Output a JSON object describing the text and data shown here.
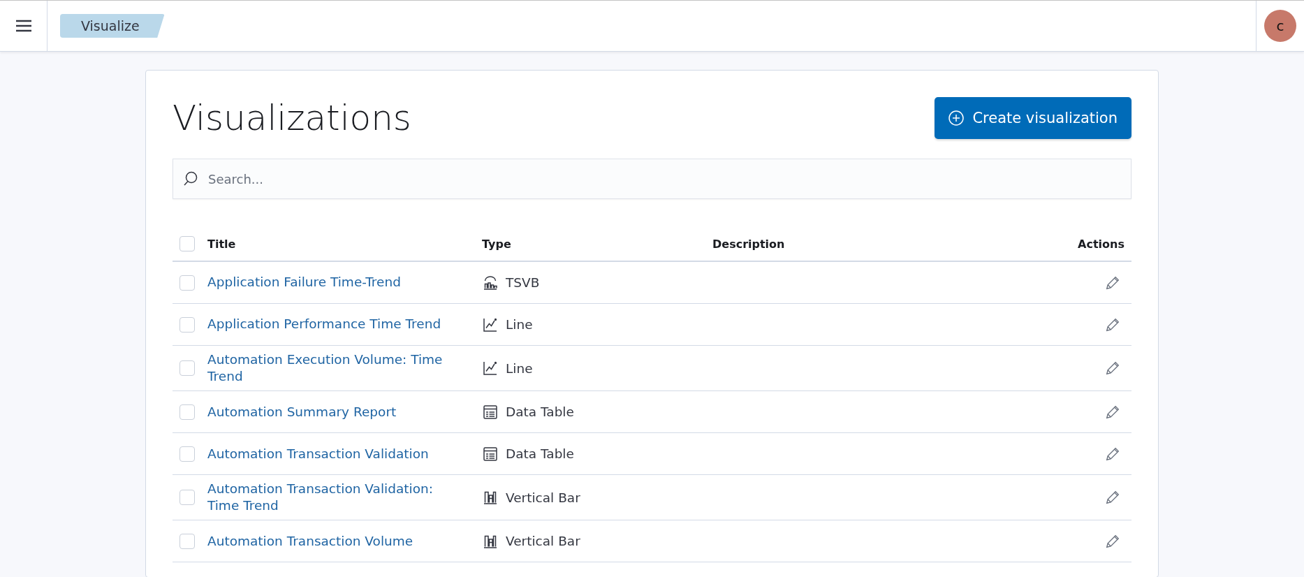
{
  "header": {
    "breadcrumb": "Visualize",
    "avatar": "c"
  },
  "page": {
    "title": "Visualizations",
    "create_button": "Create visualization",
    "search": {
      "placeholder": "Search..."
    }
  },
  "table": {
    "select_all_checked": false,
    "columns": [
      "Title",
      "Type",
      "Description",
      "Actions"
    ],
    "rows": [
      {
        "checked": false,
        "title": "Application Failure Time-Trend",
        "type": {
          "kind": "tsvb",
          "label": "TSVB"
        }
      },
      {
        "checked": false,
        "title": "Application Performance Time Trend",
        "type": {
          "kind": "line",
          "label": "Line"
        }
      },
      {
        "checked": false,
        "title": "Automation Execution Volume: Time Trend",
        "type": {
          "kind": "line",
          "label": "Line"
        }
      },
      {
        "checked": false,
        "title": "Automation Summary Report",
        "type": {
          "kind": "table",
          "label": "Data Table"
        }
      },
      {
        "checked": false,
        "title": "Automation Transaction Validation",
        "type": {
          "kind": "table",
          "label": "Data Table"
        }
      },
      {
        "checked": false,
        "title": "Automation Transaction Validation: Time Trend",
        "type": {
          "kind": "bar",
          "label": "Vertical Bar"
        }
      },
      {
        "checked": false,
        "title": "Automation Transaction Volume",
        "type": {
          "kind": "bar",
          "label": "Vertical Bar"
        }
      }
    ]
  }
}
